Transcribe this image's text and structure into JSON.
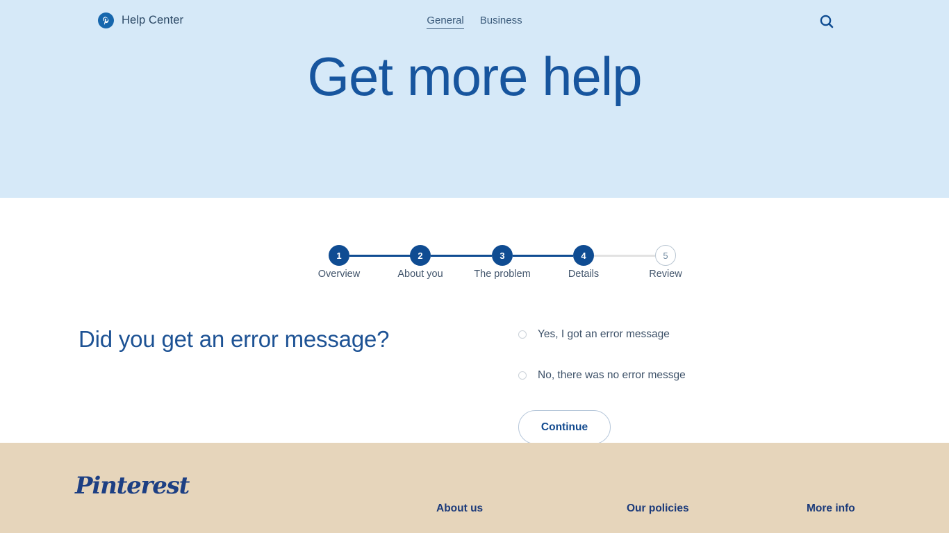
{
  "header": {
    "brand_icon": "pinterest-p-icon",
    "brand_label": "Help Center",
    "tabs": [
      {
        "label": "General",
        "active": true
      },
      {
        "label": "Business",
        "active": false
      }
    ],
    "search_icon": "search-icon",
    "hero_title": "Get more help",
    "hero_bg": "#d6e9f8",
    "hero_title_color": "#17559e"
  },
  "stepper": {
    "current_step": 4,
    "steps": [
      {
        "number": "1",
        "label": "Overview",
        "state": "done"
      },
      {
        "number": "2",
        "label": "About you",
        "state": "done"
      },
      {
        "number": "3",
        "label": "The problem",
        "state": "done"
      },
      {
        "number": "4",
        "label": "Details",
        "state": "done"
      },
      {
        "number": "5",
        "label": "Review",
        "state": "todo"
      }
    ],
    "done_color": "#0f4c92",
    "todo_color": "#b9c6d2"
  },
  "form": {
    "question": "Did you get an error message?",
    "options": [
      {
        "label": "Yes, I got an error message",
        "selected": false
      },
      {
        "label": "No, there was no error messge",
        "selected": false
      }
    ],
    "continue_label": "Continue"
  },
  "footer": {
    "logo_text": "Pinterest",
    "bg": "#e6d5bb",
    "columns": [
      {
        "title": "About us"
      },
      {
        "title": "Our policies"
      },
      {
        "title": "More info"
      }
    ]
  }
}
